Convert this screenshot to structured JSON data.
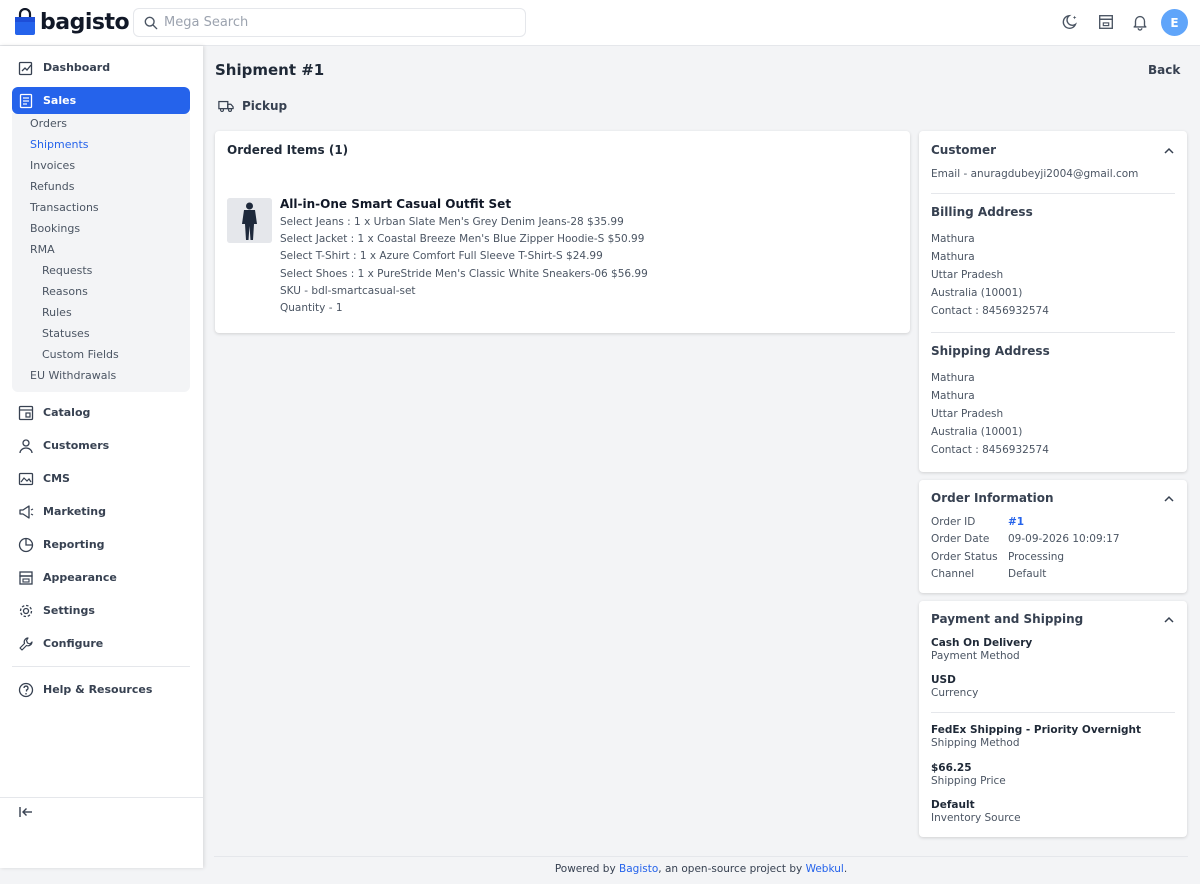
{
  "brand": {
    "name": "bagisto",
    "color": "#2563eb"
  },
  "search": {
    "placeholder": "Mega Search"
  },
  "user": {
    "initial": "E"
  },
  "sidebar": {
    "items": [
      {
        "label": "Dashboard",
        "icon": "dashboard-icon"
      },
      {
        "label": "Sales",
        "icon": "sales-icon",
        "active": true
      },
      {
        "label": "Catalog",
        "icon": "catalog-icon"
      },
      {
        "label": "Customers",
        "icon": "customers-icon"
      },
      {
        "label": "CMS",
        "icon": "cms-icon"
      },
      {
        "label": "Marketing",
        "icon": "marketing-icon"
      },
      {
        "label": "Reporting",
        "icon": "reporting-icon"
      },
      {
        "label": "Appearance",
        "icon": "appearance-icon"
      },
      {
        "label": "Settings",
        "icon": "settings-icon"
      },
      {
        "label": "Configure",
        "icon": "configure-icon"
      },
      {
        "label": "Help & Resources",
        "icon": "help-icon"
      }
    ],
    "sales_sub": [
      "Orders",
      "Shipments",
      "Invoices",
      "Refunds",
      "Transactions",
      "Bookings",
      "RMA",
      "Requests",
      "Reasons",
      "Rules",
      "Statuses",
      "Custom Fields",
      "EU Withdrawals"
    ]
  },
  "page": {
    "title": "Shipment #1",
    "back_label": "Back",
    "pickup_label": "Pickup"
  },
  "ordered_items": {
    "title": "Ordered Items (1)",
    "product": {
      "name": "All-in-One Smart Casual Outfit Set",
      "lines": [
        "Select Jeans : 1 x Urban Slate Men's Grey Denim Jeans-28 $35.99",
        "Select Jacket : 1 x Coastal Breeze Men's Blue Zipper Hoodie-S $50.99",
        "Select T-Shirt : 1 x Azure Comfort Full Sleeve T-Shirt-S $24.99",
        "Select Shoes : 1 x PureStride Men's Classic White Sneakers-06 $56.99",
        "SKU - bdl-smartcasual-set",
        "Quantity - 1"
      ]
    }
  },
  "customer": {
    "title": "Customer",
    "email": "Email - anuragdubeyji2004@gmail.com",
    "billing_title": "Billing Address",
    "billing": [
      "Mathura",
      "Mathura",
      "Uttar Pradesh",
      "Australia (10001)",
      "Contact : 8456932574"
    ],
    "shipping_title": "Shipping Address",
    "shipping": [
      "Mathura",
      "Mathura",
      "Uttar Pradesh",
      "Australia (10001)",
      "Contact : 8456932574"
    ]
  },
  "order_info": {
    "title": "Order Information",
    "rows": [
      {
        "label": "Order ID",
        "value": "#1"
      },
      {
        "label": "Order Date",
        "value": "09-09-2026 10:09:17"
      },
      {
        "label": "Order Status",
        "value": "Processing"
      },
      {
        "label": "Channel",
        "value": "Default"
      }
    ]
  },
  "payment": {
    "title": "Payment and Shipping",
    "method": "Cash On Delivery",
    "method_label": "Payment Method",
    "currency": "USD",
    "currency_label": "Currency",
    "shipping_method": "FedEx Shipping - Priority Overnight",
    "shipping_method_label": "Shipping Method",
    "shipping_price": "$66.25",
    "shipping_price_label": "Shipping Price",
    "inventory_source": "Default",
    "inventory_source_label": "Inventory Source"
  },
  "footer": {
    "prefix": "Powered by ",
    "link1": "Bagisto",
    "middle": ", an open-source project by ",
    "link2": "Webkul",
    "suffix": "."
  }
}
